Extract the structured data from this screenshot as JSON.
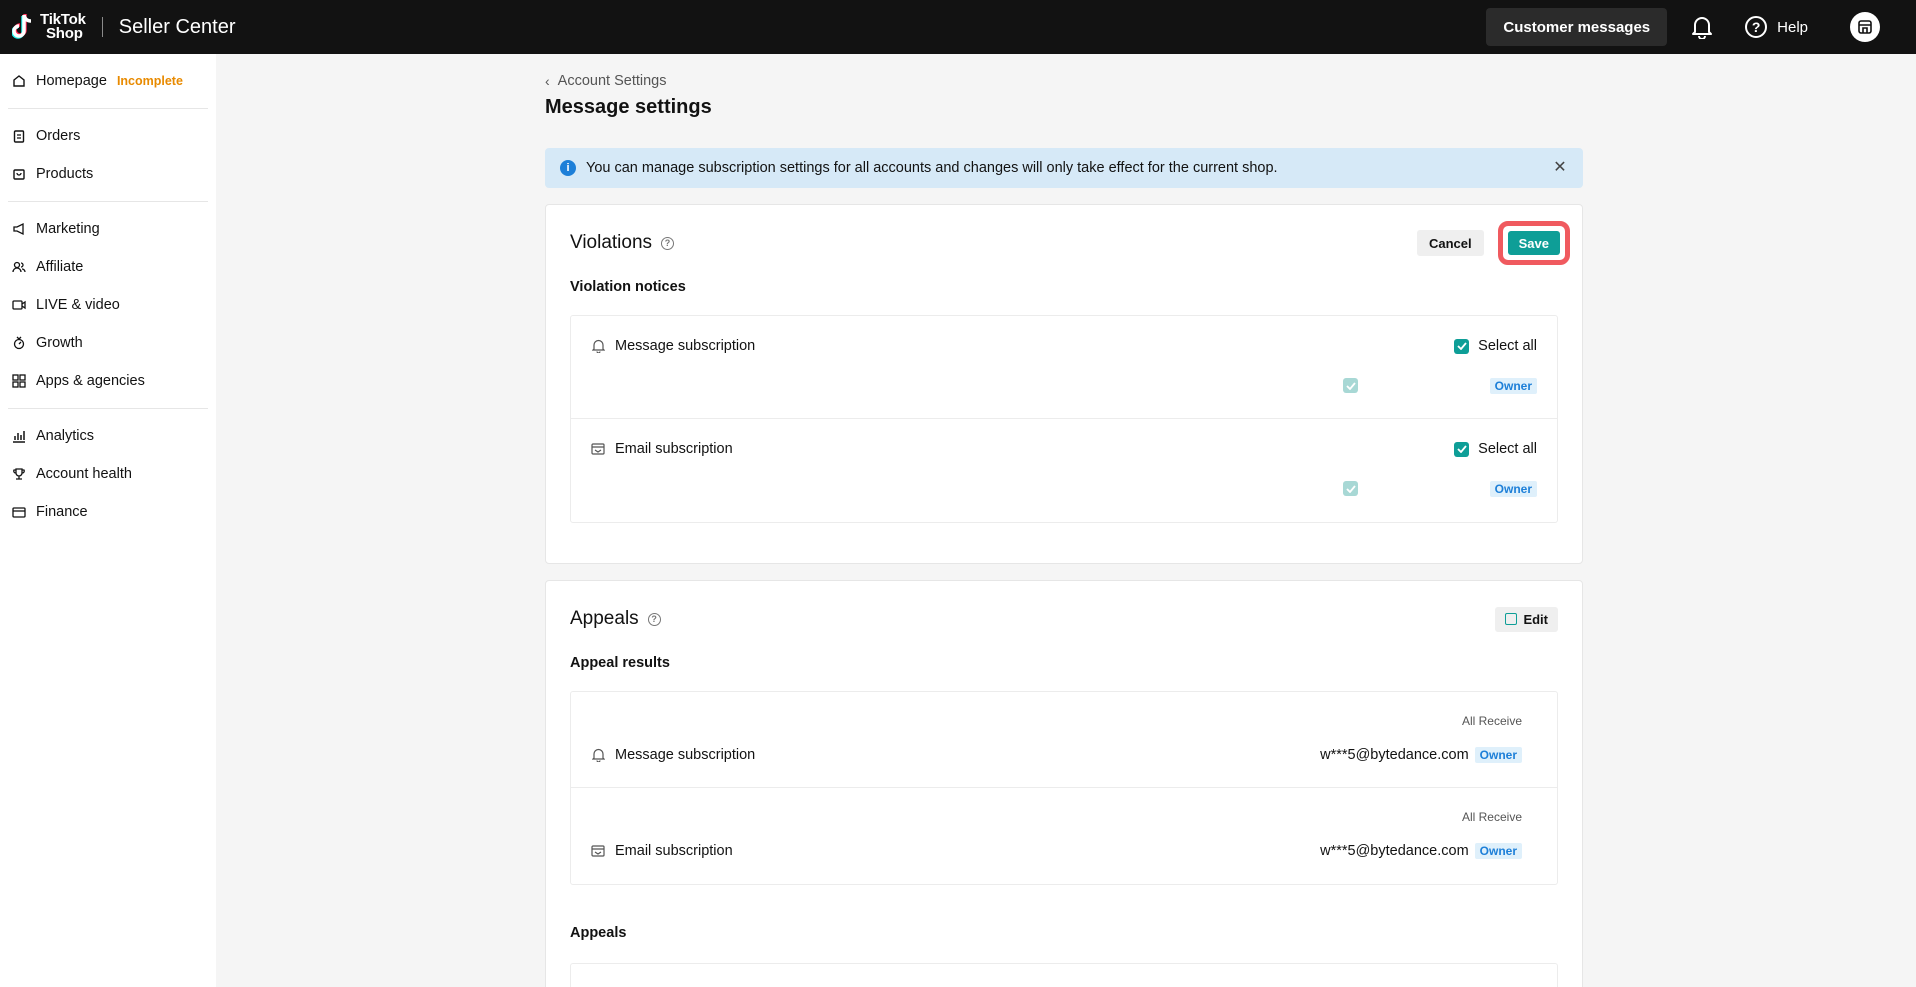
{
  "header": {
    "logo_text_line1": "TikTok",
    "logo_text_line2": "Shop",
    "app_title": "Seller Center",
    "customer_messages_label": "Customer messages",
    "help_label": "Help"
  },
  "sidebar": {
    "groups": [
      [
        {
          "label": "Homepage",
          "badge": "Incomplete",
          "icon": "home-icon"
        }
      ],
      [
        {
          "label": "Orders",
          "icon": "clipboard-icon"
        },
        {
          "label": "Products",
          "icon": "bag-icon"
        }
      ],
      [
        {
          "label": "Marketing",
          "icon": "megaphone-icon"
        },
        {
          "label": "Affiliate",
          "icon": "people-icon"
        },
        {
          "label": "LIVE & video",
          "icon": "video-icon"
        },
        {
          "label": "Growth",
          "icon": "growth-icon"
        },
        {
          "label": "Apps & agencies",
          "icon": "grid-icon"
        }
      ],
      [
        {
          "label": "Analytics",
          "icon": "chart-icon"
        },
        {
          "label": "Account health",
          "icon": "trophy-icon"
        },
        {
          "label": "Finance",
          "icon": "wallet-icon"
        }
      ]
    ]
  },
  "breadcrumb": "Account Settings",
  "page_title": "Message settings",
  "banner_text": "You can manage subscription settings for all accounts and changes will only take effect for the current shop.",
  "violations": {
    "title": "Violations",
    "cancel_label": "Cancel",
    "save_label": "Save",
    "section_label": "Violation notices",
    "rows": [
      {
        "label": "Message subscription",
        "select_all": "Select all",
        "role": "Owner"
      },
      {
        "label": "Email subscription",
        "select_all": "Select all",
        "role": "Owner"
      }
    ]
  },
  "appeals": {
    "title": "Appeals",
    "edit_label": "Edit",
    "section_label": "Appeal results",
    "rows": [
      {
        "label": "Message subscription",
        "column": "All Receive",
        "email": "w***5@bytedance.com",
        "role": "Owner"
      },
      {
        "label": "Email subscription",
        "column": "All Receive",
        "email": "w***5@bytedance.com",
        "role": "Owner"
      }
    ],
    "second_section_label": "Appeals"
  },
  "colors": {
    "accent": "#0e9e97",
    "highlight": "#f05a5f",
    "warning": "#e88a00",
    "info": "#1d7fd8"
  }
}
